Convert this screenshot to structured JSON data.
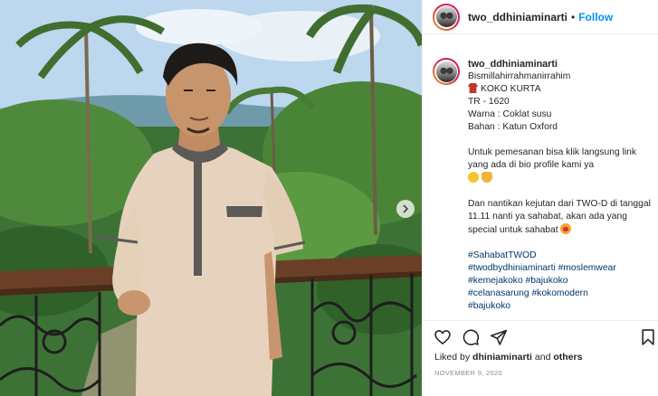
{
  "post": {
    "username": "two_ddhiniaminarti",
    "separator": "•",
    "follow_label": "Follow"
  },
  "caption": {
    "username": "two_ddhiniaminarti",
    "lines": [
      "Bismillahirrahmanirrahim",
      "KOKO KURTA",
      "TR - 1620",
      "Warna : Coklat susu",
      "Bahan : Katun Oxford"
    ],
    "paragraph1": "Untuk pemesanan bisa klik langsung link yang ada di bio profile kami ya",
    "paragraph2": "Dan nantikan kejutan dari TWO-D di tanggal 11.11 nanti ya sahabat, akan ada yang special untuk sahabat",
    "hashtags": [
      "#SahabatTWOD",
      "#twodbydhiniaminarti",
      "#moslemwear",
      "#kemejakoko",
      "#bajukoko",
      "#celanasarung",
      "#kokomodern",
      "#bajukoko"
    ]
  },
  "actions": {
    "like_icon": "heart-icon",
    "comment_icon": "comment-icon",
    "share_icon": "share-icon",
    "save_icon": "bookmark-icon"
  },
  "engagement": {
    "liked_by_prefix": "Liked by ",
    "liked_by_user": "dhiniaminarti",
    "liked_by_suffix": " and ",
    "others": "others"
  },
  "timestamp": "NOVEMBER 9, 2020",
  "colors": {
    "follow_blue": "#0095f6",
    "hashtag_blue": "#00376b",
    "text": "#262626",
    "muted": "#8e8e8e"
  }
}
